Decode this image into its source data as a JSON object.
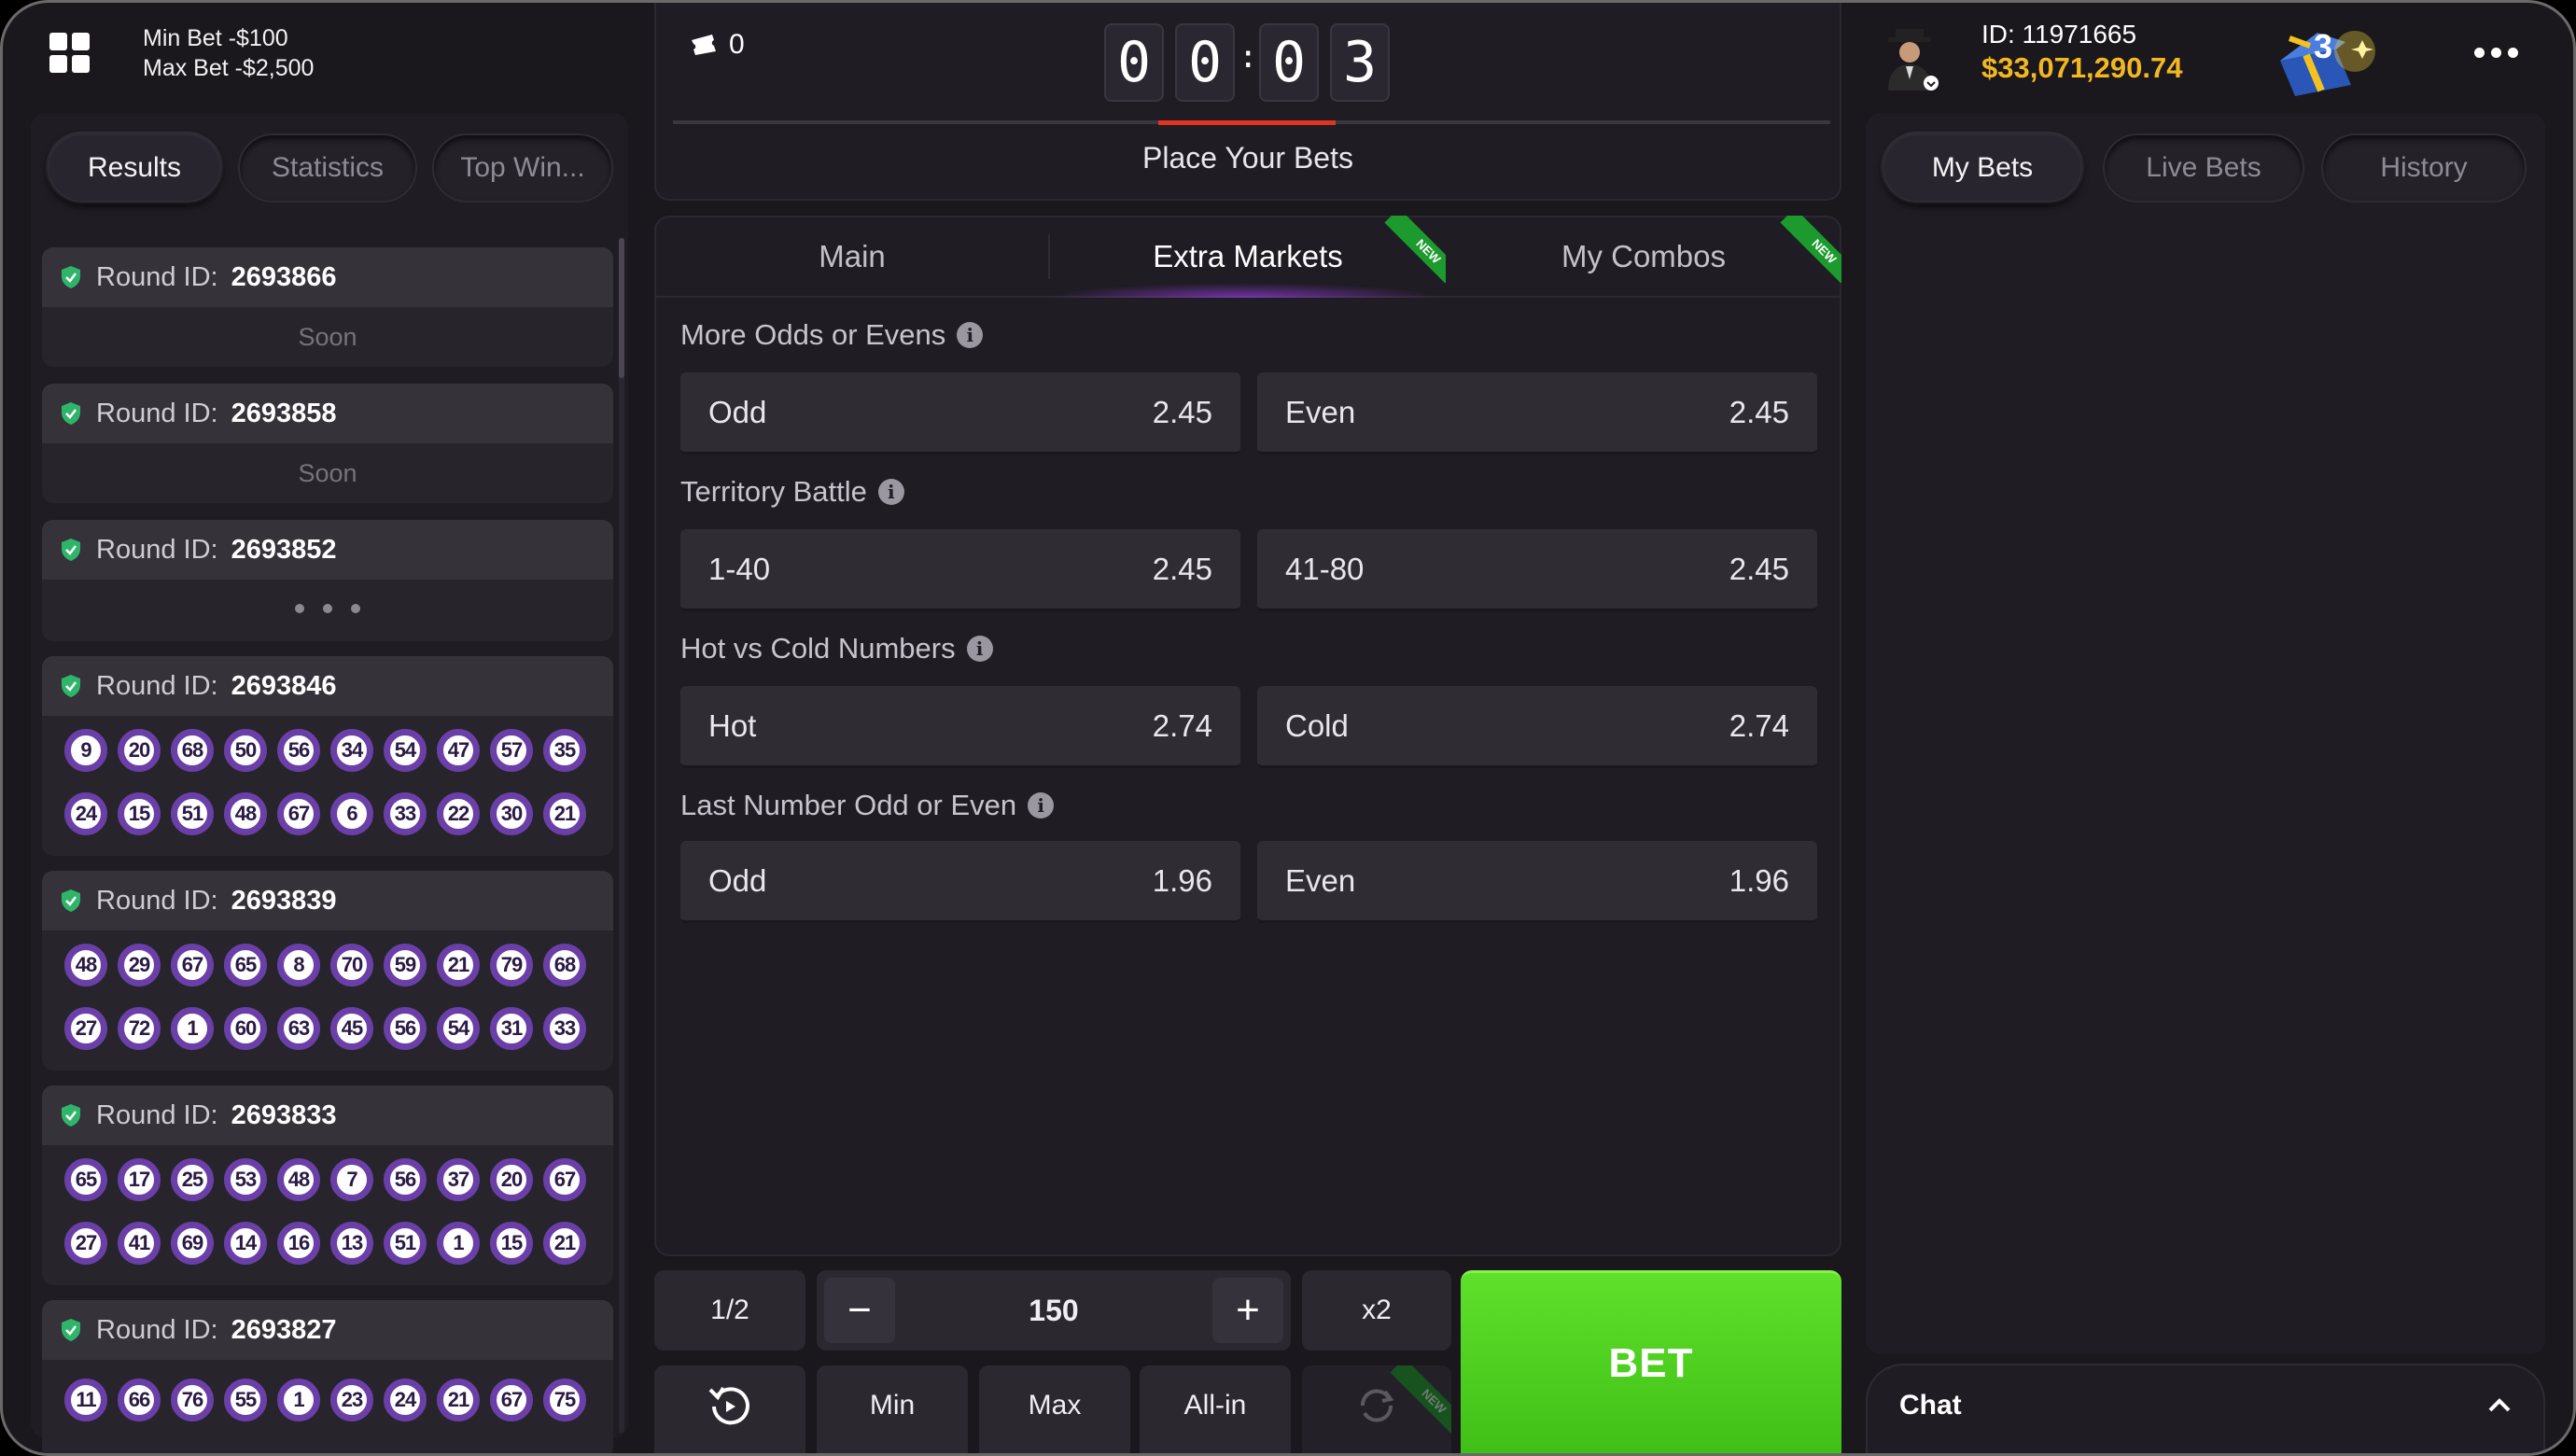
{
  "header": {
    "min_bet": "Min Bet -$100",
    "max_bet": "Max Bet -$2,500",
    "tickets": "0",
    "timer_digits": [
      "0",
      "0",
      "0",
      "3"
    ],
    "timer_colon": ":",
    "place_bets": "Place Your Bets"
  },
  "left_tabs": [
    "Results",
    "Statistics",
    "Top Win..."
  ],
  "rounds": [
    {
      "label": "Round ID:",
      "id": "2693866",
      "status": "Soon"
    },
    {
      "label": "Round ID:",
      "id": "2693858",
      "status": "Soon"
    },
    {
      "label": "Round ID:",
      "id": "2693852",
      "status": "loading"
    },
    {
      "label": "Round ID:",
      "id": "2693846",
      "row1": [
        "9",
        "20",
        "68",
        "50",
        "56",
        "34",
        "54",
        "47",
        "57",
        "35"
      ],
      "row2": [
        "24",
        "15",
        "51",
        "48",
        "67",
        "6",
        "33",
        "22",
        "30",
        "21"
      ]
    },
    {
      "label": "Round ID:",
      "id": "2693839",
      "row1": [
        "48",
        "29",
        "67",
        "65",
        "8",
        "70",
        "59",
        "21",
        "79",
        "68"
      ],
      "row2": [
        "27",
        "72",
        "1",
        "60",
        "63",
        "45",
        "56",
        "54",
        "31",
        "33"
      ]
    },
    {
      "label": "Round ID:",
      "id": "2693833",
      "row1": [
        "65",
        "17",
        "25",
        "53",
        "48",
        "7",
        "56",
        "37",
        "20",
        "67"
      ],
      "row2": [
        "27",
        "41",
        "69",
        "14",
        "16",
        "13",
        "51",
        "1",
        "15",
        "21"
      ]
    },
    {
      "label": "Round ID:",
      "id": "2693827",
      "row1": [
        "11",
        "66",
        "76",
        "55",
        "1",
        "23",
        "24",
        "21",
        "67",
        "75"
      ]
    }
  ],
  "market_tabs": {
    "main": "Main",
    "extra": "Extra Markets",
    "combos": "My Combos",
    "new_badge": "NEW"
  },
  "markets": [
    {
      "title": "More Odds or Evens",
      "options": [
        {
          "label": "Odd",
          "odds": "2.45"
        },
        {
          "label": "Even",
          "odds": "2.45"
        }
      ]
    },
    {
      "title": "Territory Battle",
      "options": [
        {
          "label": "1-40",
          "odds": "2.45"
        },
        {
          "label": "41-80",
          "odds": "2.45"
        }
      ]
    },
    {
      "title": "Hot vs Cold Numbers",
      "options": [
        {
          "label": "Hot",
          "odds": "2.74"
        },
        {
          "label": "Cold",
          "odds": "2.74"
        }
      ]
    },
    {
      "title": "Last Number Odd or Even",
      "options": [
        {
          "label": "Odd",
          "odds": "1.96"
        },
        {
          "label": "Even",
          "odds": "1.96"
        }
      ]
    }
  ],
  "controls": {
    "half": "1/2",
    "minus": "−",
    "amount": "150",
    "plus": "+",
    "double": "x2",
    "min": "Min",
    "max": "Max",
    "allin": "All-in",
    "bet": "BET"
  },
  "user": {
    "id": "ID: 11971665",
    "balance": "$33,071,290.74",
    "gift_count": "3"
  },
  "right_tabs": [
    "My Bets",
    "Live Bets",
    "History"
  ],
  "chat": {
    "label": "Chat"
  },
  "colors": {
    "accent_green": "#3fbf16",
    "balance_gold": "#f3b820",
    "ball_ring": "#6a3fa8",
    "timer_red": "#e2331e"
  }
}
